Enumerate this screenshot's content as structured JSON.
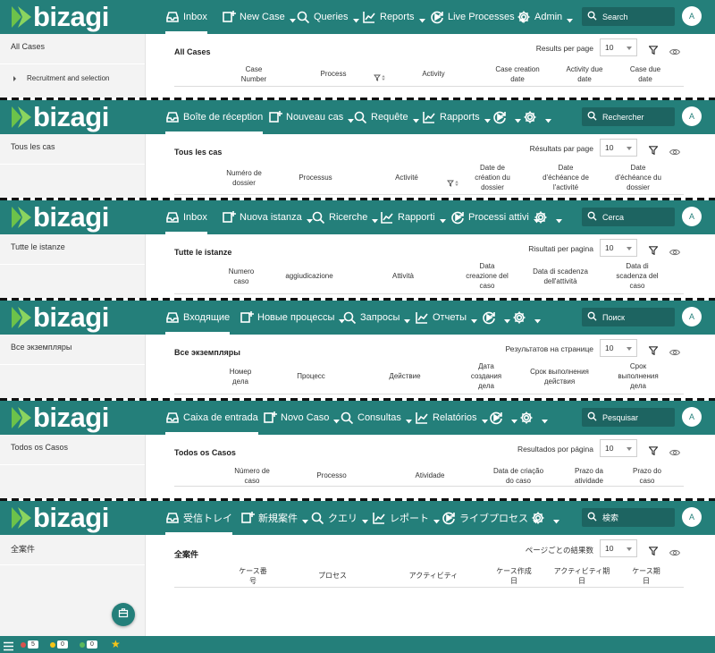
{
  "brand": {
    "logo_text": "bizagi"
  },
  "colors": {
    "topbar": "#247f7a",
    "search_bg": "#1d6461",
    "footer": "#247f7a",
    "red": "#d9534f",
    "yellow": "#f5c518",
    "green": "#5cb85c"
  },
  "panels": [
    {
      "lang": "en",
      "nav": {
        "inbox": "Inbox",
        "new_case": "New Case",
        "queries": "Queries",
        "reports": "Reports",
        "live": "Live Processes",
        "admin": "Admin"
      },
      "search_placeholder": "Search",
      "avatar": "A",
      "sidebar": {
        "title": "All Cases",
        "sub": "Recruitment and selection"
      },
      "main": {
        "title": "All Cases",
        "rpp_label": "Results per page",
        "rpp_value": "10"
      },
      "columns": [
        "Case\nNumber",
        "Process",
        "Activity",
        "Case creation\ndate",
        "Activity due\ndate",
        "Case due\ndate"
      ]
    },
    {
      "lang": "fr",
      "nav": {
        "inbox": "Boîte de réception",
        "new_case": "Nouveau cas",
        "queries": "Requête",
        "reports": "Rapports"
      },
      "search_placeholder": "Rechercher",
      "avatar": "A",
      "sidebar": {
        "title": "Tous les cas"
      },
      "main": {
        "title": "Tous les cas",
        "rpp_label": "Résultats par page",
        "rpp_value": "10"
      },
      "columns": [
        "Numéro de\ndossier",
        "Processus",
        "Activité",
        "Date de\ncréation du\ndossier",
        "Date\nd'échéance de\nl'activité",
        "Date\nd'échéance du\ndossier"
      ]
    },
    {
      "lang": "it",
      "nav": {
        "inbox": "Inbox",
        "new_case": "Nuova istanza",
        "queries": "Ricerche",
        "reports": "Rapporti",
        "live": "Processi attivi"
      },
      "search_placeholder": "Cerca",
      "avatar": "A",
      "sidebar": {
        "title": "Tutte le istanze"
      },
      "main": {
        "title": "Tutte le istanze",
        "rpp_label": "Risultati per pagina",
        "rpp_value": "10"
      },
      "columns": [
        "Numero\ncaso",
        "aggiudicazione",
        "Attività",
        "Data\ncreazione del\ncaso",
        "Data di scadenza\ndell'attività",
        "Data di\nscadenza del\ncaso"
      ]
    },
    {
      "lang": "ru",
      "nav": {
        "inbox": "Входящие",
        "new_case": "Новые процессы",
        "queries": "Запросы",
        "reports": "Отчеты"
      },
      "search_placeholder": "Поиск",
      "avatar": "A",
      "sidebar": {
        "title": "Все экземпляры"
      },
      "main": {
        "title": "Все экземпляры",
        "rpp_label": "Результатов на странице",
        "rpp_value": "10"
      },
      "columns": [
        "Номер\nдела",
        "Процесс",
        "Действие",
        "Дата\nсоздания\nдела",
        "Срок выполнения\nдействия",
        "Срок\nвыполнения\nдела"
      ]
    },
    {
      "lang": "pt",
      "nav": {
        "inbox": "Caixa de entrada",
        "new_case": "Novo Caso",
        "queries": "Consultas",
        "reports": "Relatórios"
      },
      "search_placeholder": "Pesquisar",
      "avatar": "A",
      "sidebar": {
        "title": "Todos os Casos"
      },
      "main": {
        "title": "Todos os Casos",
        "rpp_label": "Resultados por página",
        "rpp_value": "10"
      },
      "columns": [
        "Número de\ncaso",
        "Processo",
        "Atividade",
        "Data de criação\ndo caso",
        "Prazo da\natividade",
        "Prazo do\ncaso"
      ]
    },
    {
      "lang": "ja",
      "nav": {
        "inbox": "受信トレイ",
        "new_case": "新規案件",
        "queries": "クエリ",
        "reports": "レポート",
        "live": "ライブプロセス"
      },
      "search_placeholder": "検索",
      "avatar": "A",
      "sidebar": {
        "title": "全案件"
      },
      "main": {
        "title": "全案件",
        "rpp_label": "ページごとの結果数",
        "rpp_value": "10"
      },
      "columns": [
        "ケース番\n号",
        "プロセス",
        "アクティビティ",
        "ケース作成\n日",
        "アクティビティ期\n日",
        "ケース期\n日"
      ]
    }
  ],
  "footer": {
    "red_count": "5",
    "yellow_count": "0",
    "green_count": "0"
  }
}
